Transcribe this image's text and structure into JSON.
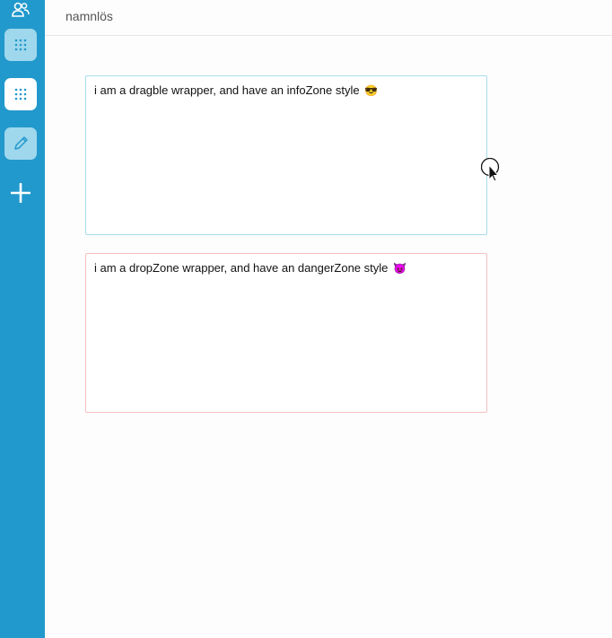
{
  "sidebar": {
    "icons": [
      "users-icon",
      "grid-icon",
      "grid-icon",
      "pencil-icon",
      "plus-icon"
    ],
    "colors": {
      "bg": "#2299cc",
      "highlight": "#9fd7ec",
      "active": "#ffffff"
    }
  },
  "header": {
    "title": "namnlös"
  },
  "zones": {
    "info": {
      "text": "i am a dragble wrapper, and have an infoZone style",
      "emoji": "😎",
      "border_color": "#a8dcec"
    },
    "danger": {
      "text": "i am a dropZone wrapper, and have an dangerZone style",
      "emoji": "😈",
      "border_color": "#f4c0c0"
    }
  }
}
